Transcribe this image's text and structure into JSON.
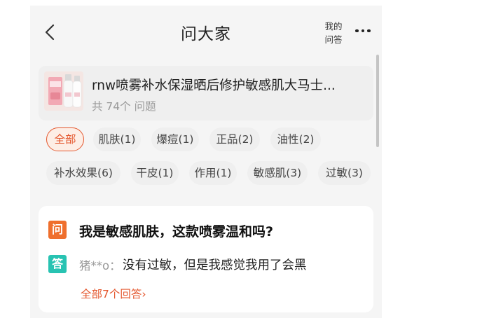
{
  "navbar": {
    "title": "问大家",
    "my_qa_line1": "我的",
    "my_qa_line2": "问答",
    "back_icon": "chevron-left-icon",
    "more_icon": "more-dots-icon"
  },
  "product": {
    "name": "rnw喷雾补水保湿晒后修护敏感肌大马士...",
    "count": "共 74个 问题"
  },
  "tags": [
    {
      "label": "全部",
      "active": true
    },
    {
      "label": "肌肤(1)"
    },
    {
      "label": "爆痘(1)"
    },
    {
      "label": "正品(2)"
    },
    {
      "label": "油性(2)"
    },
    {
      "label": "补水效果(6)"
    },
    {
      "label": "干皮(1)"
    },
    {
      "label": "作用(1)"
    },
    {
      "label": "敏感肌(3)"
    },
    {
      "label": "过敏(3)"
    }
  ],
  "qa": {
    "q_badge": "问",
    "question": "我是敏感肌肤，这款喷雾温和吗?",
    "a_badge": "答",
    "answer_user": "猪**o：",
    "answer_text": "没有过敏，但是我感觉我用了会黑",
    "all_answers": "全部7个回答",
    "all_answers_arrow": "›"
  },
  "colors": {
    "accent": "#e4572e",
    "question_badge": "#ef6f2d",
    "answer_badge": "#28c3b2",
    "background": "#f5f5f5"
  }
}
